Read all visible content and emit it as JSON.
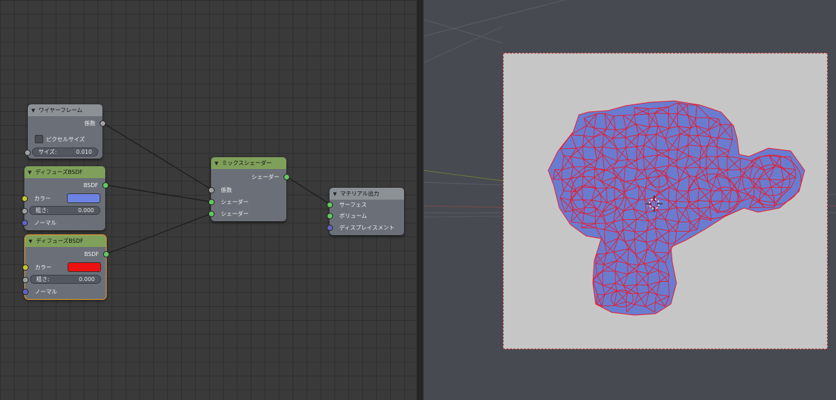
{
  "colors": {
    "header_grey": "#8c9196",
    "header_green": "#7fa05a",
    "node_body": "#6b7078",
    "socket_float": "#a1a1a1",
    "socket_shader": "#63c763",
    "socket_color": "#c7c729",
    "socket_vector": "#6363c7",
    "diffuse1_color": "#6d83e3",
    "diffuse2_color": "#ee1111",
    "mesh_fill": "#6a7cd0",
    "wire_color": "#ea1a2a",
    "selected_outline": "#f0a030"
  },
  "nodes": {
    "wireframe": {
      "title": "ワイヤーフレーム",
      "output_label": "係数",
      "checkbox_label": "ピクセルサイズ",
      "size_label": "サイズ:",
      "size_value": "0.010"
    },
    "diffuse1": {
      "title": "ディフューズBSDF",
      "output_label": "BSDF",
      "color_label": "カラー",
      "roughness_label": "粗さ:",
      "roughness_value": "0.000",
      "normal_label": "ノーマル"
    },
    "diffuse2": {
      "title": "ディフューズBSDF",
      "output_label": "BSDF",
      "color_label": "カラー",
      "roughness_label": "粗さ:",
      "roughness_value": "0.000",
      "normal_label": "ノーマル"
    },
    "mix": {
      "title": "ミックスシェーダー",
      "output_label": "シェーダー",
      "fac_label": "係数",
      "shader1_label": "シェーダー",
      "shader2_label": "シェーダー"
    },
    "output": {
      "title": "マテリアル出力",
      "surface_label": "サーフェス",
      "volume_label": "ボリューム",
      "displacement_label": "ディスプレイスメント"
    }
  },
  "viewport": {
    "icons": [
      "3d-cursor-icon"
    ]
  }
}
